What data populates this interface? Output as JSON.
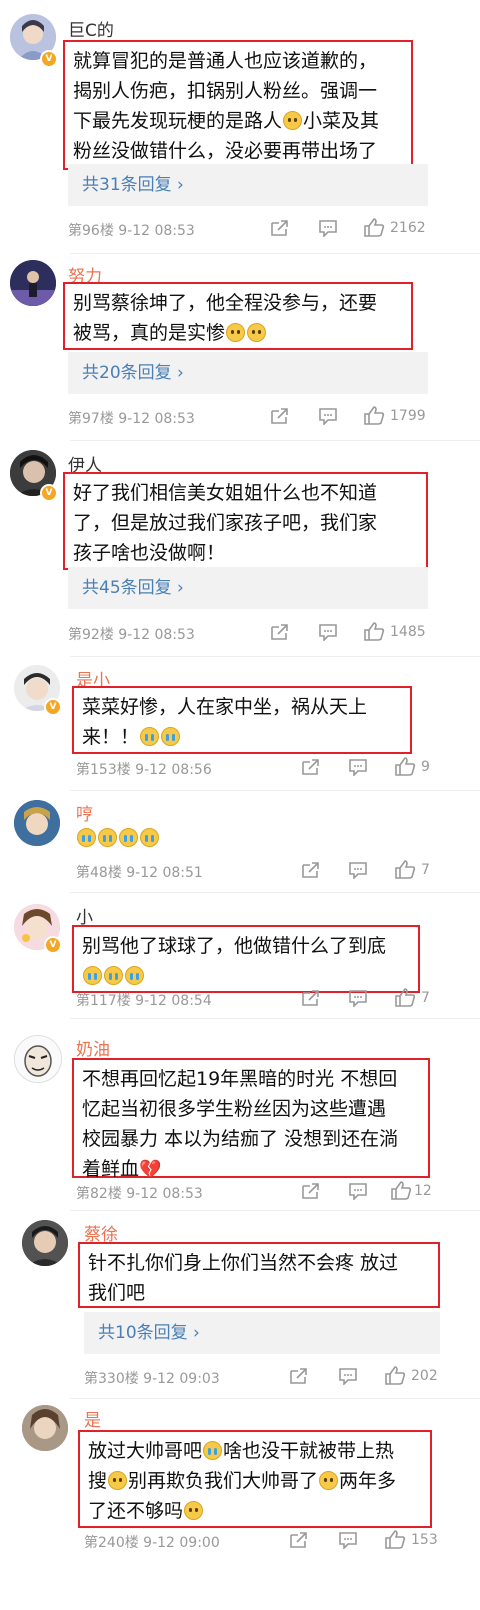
{
  "comments": [
    {
      "user": "巨C的",
      "lines": [
        "就算冒犯的是普通人也应该道歉的，",
        "揭别人伤疤，扣锅别人粉丝。强调一",
        "下最先发现玩梗的是路人",
        "小菜及其",
        "粉丝没做错什么，没必要再带出场了"
      ],
      "replies": "共31条回复 ›",
      "meta": "第96楼  9-12 08:53",
      "likes": "2162"
    },
    {
      "user": "努力",
      "lines": [
        "别骂蔡徐坤了，他全程没参与，还要",
        "被骂，真的是实惨"
      ],
      "replies": "共20条回复 ›",
      "meta": "第97楼  9-12 08:53",
      "likes": "1799"
    },
    {
      "user": "伊人",
      "lines": [
        "好了我们相信美女姐姐什么也不知道",
        "了，但是放过我们家孩子吧，我们家",
        "孩子啥也没做啊！"
      ],
      "replies": "共45条回复 ›",
      "meta": "第92楼  9-12 08:53",
      "likes": "1485"
    },
    {
      "user": "是小",
      "lines": [
        "菜菜好惨，人在家中坐，祸从天上",
        "来！！"
      ],
      "meta": "第153楼  9-12 08:56",
      "likes": "9"
    },
    {
      "user": "哼",
      "lines": [
        ""
      ],
      "meta": "第48楼  9-12 08:51",
      "likes": "7"
    },
    {
      "user": "小",
      "lines": [
        "别骂他了球球了，他做错什么了到底",
        ""
      ],
      "meta": "第117楼  9-12 08:54",
      "likes": "7"
    },
    {
      "user": "奶油",
      "lines": [
        "不想再回忆起19年黑暗的时光 不想回",
        "忆起当初很多学生粉丝因为这些遭遇",
        "校园暴力 本以为结痂了 没想到还在淌",
        "着鲜血"
      ],
      "meta": "第82楼  9-12 08:53",
      "likes": "12"
    },
    {
      "user": "蔡徐",
      "lines": [
        "针不扎你们身上你们当然不会疼 放过",
        "我们吧"
      ],
      "replies": "共10条回复 ›",
      "meta": "第330楼  9-12 09:03",
      "likes": "202"
    },
    {
      "user": "是",
      "lines": [
        "放过大帅哥吧",
        "啥也没干就被带上热",
        "搜",
        "别再欺负我们大帅哥了",
        "两年多",
        "了还不够吗"
      ],
      "meta": "第240楼  9-12 09:00",
      "likes": "153"
    }
  ]
}
